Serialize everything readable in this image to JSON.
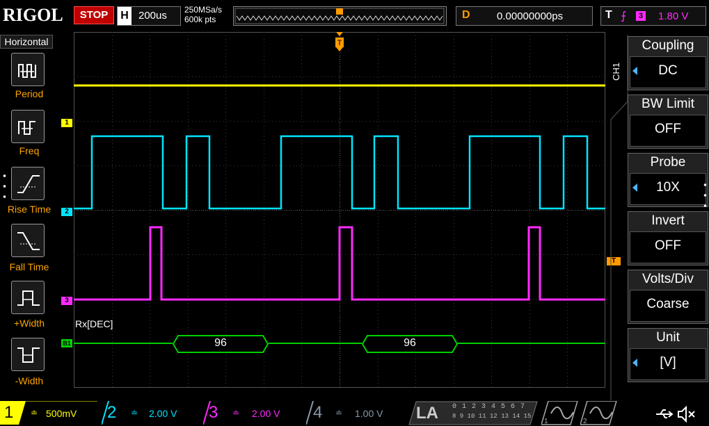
{
  "brand": "RIGOL",
  "run_state": "STOP",
  "horizontal": {
    "key": "H",
    "timebase": "200us"
  },
  "acquisition": {
    "sample_rate": "250MSa/s",
    "memory_depth": "600k pts"
  },
  "delay": {
    "key": "D",
    "value": "0.00000000ps"
  },
  "trigger": {
    "key": "T",
    "source": "3",
    "level": "1.80 V",
    "edge_icon": "rising-edge-icon"
  },
  "left_menu": {
    "title": "Horizontal",
    "items": [
      {
        "label": "Period",
        "icon": "period-icon"
      },
      {
        "label": "Freq",
        "icon": "freq-icon"
      },
      {
        "label": "Rise Time",
        "icon": "rise-time-icon"
      },
      {
        "label": "Fall Time",
        "icon": "fall-time-icon"
      },
      {
        "label": "+Width",
        "icon": "positive-width-icon"
      },
      {
        "label": "-Width",
        "icon": "negative-width-icon"
      }
    ]
  },
  "right_menu": {
    "channel_tag": "CH1",
    "items": [
      {
        "title": "Coupling",
        "value": "DC",
        "has_arrow": true
      },
      {
        "title": "BW Limit",
        "value": "OFF",
        "has_arrow": false
      },
      {
        "title": "Probe",
        "value": "10X",
        "has_arrow": true
      },
      {
        "title": "Invert",
        "value": "OFF",
        "has_arrow": false
      },
      {
        "title": "Volts/Div",
        "value": "Coarse",
        "has_arrow": false
      },
      {
        "title": "Unit",
        "value": "[V]",
        "has_arrow": true
      }
    ]
  },
  "waveform": {
    "ch1_marker": "1",
    "ch2_marker": "2",
    "ch3_marker": "3",
    "bus_marker": "B1",
    "bus_label": "Rx[DEC]",
    "decoded_values": [
      "96",
      "96"
    ],
    "trigger_pos_marker": "T"
  },
  "channels": [
    {
      "num": "1",
      "scale": "500mV",
      "color": "#ffff00"
    },
    {
      "num": "2",
      "scale": "2.00 V",
      "color": "#00e5ff"
    },
    {
      "num": "3",
      "scale": "2.00 V",
      "color": "#ff2aff"
    },
    {
      "num": "4",
      "scale": "1.00 V",
      "color": "#8899aa"
    }
  ],
  "la": {
    "label": "LA",
    "row1": "0 1 2 3  4 5 6 7",
    "row2": "8 9 10 11  12 13 14 15"
  },
  "colors": {
    "ch1": "#ffff00",
    "ch2": "#00e5ff",
    "ch3": "#ff2aff",
    "ch4": "#8899aa",
    "bus": "#00d000",
    "accent": "#ff9c00"
  }
}
